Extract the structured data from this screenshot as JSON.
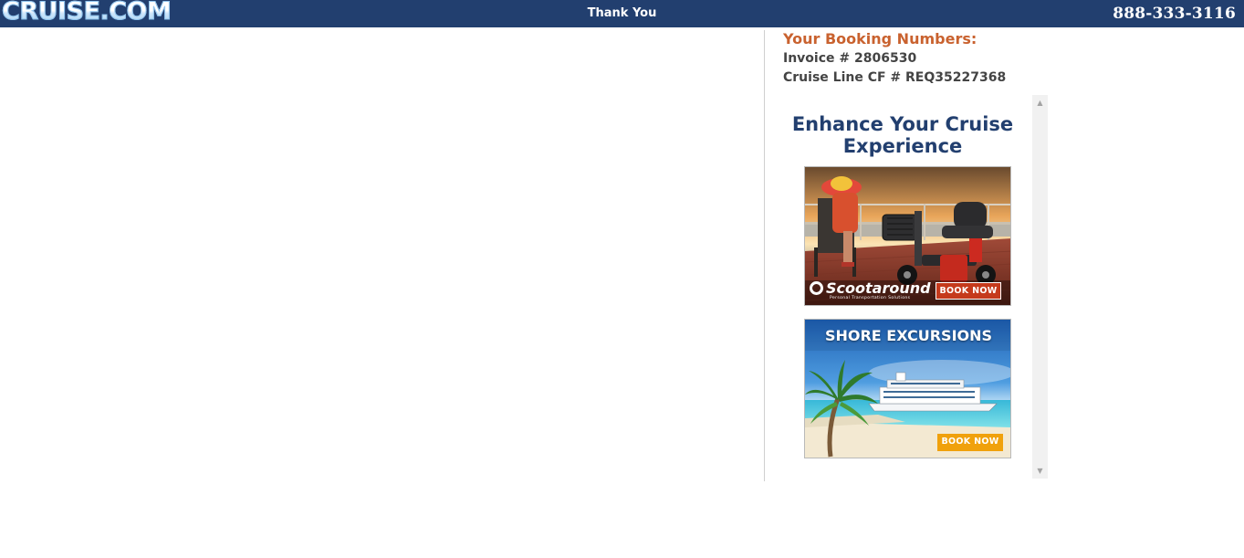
{
  "header": {
    "logo_text": "CRUISE.COM",
    "title": "Thank You",
    "phone": "888-333-3116",
    "background_color": "#223f6f"
  },
  "booking": {
    "heading": "Your Booking Numbers:",
    "invoice": "Invoice # 2806530",
    "cruise_line_cf": "Cruise Line CF # REQ35227368",
    "heading_color": "#c9622f"
  },
  "promo": {
    "title": "Enhance Your Cruise Experience",
    "title_color": "#223f6f",
    "banners": [
      {
        "brand": "Scootaround",
        "tagline": "Personal Transportation Solutions",
        "button": "BOOK NOW",
        "button_color": "#c53a1c"
      },
      {
        "headline": "SHORE EXCURSIONS",
        "button": "BOOK NOW",
        "button_color": "#f0a10c"
      }
    ]
  }
}
